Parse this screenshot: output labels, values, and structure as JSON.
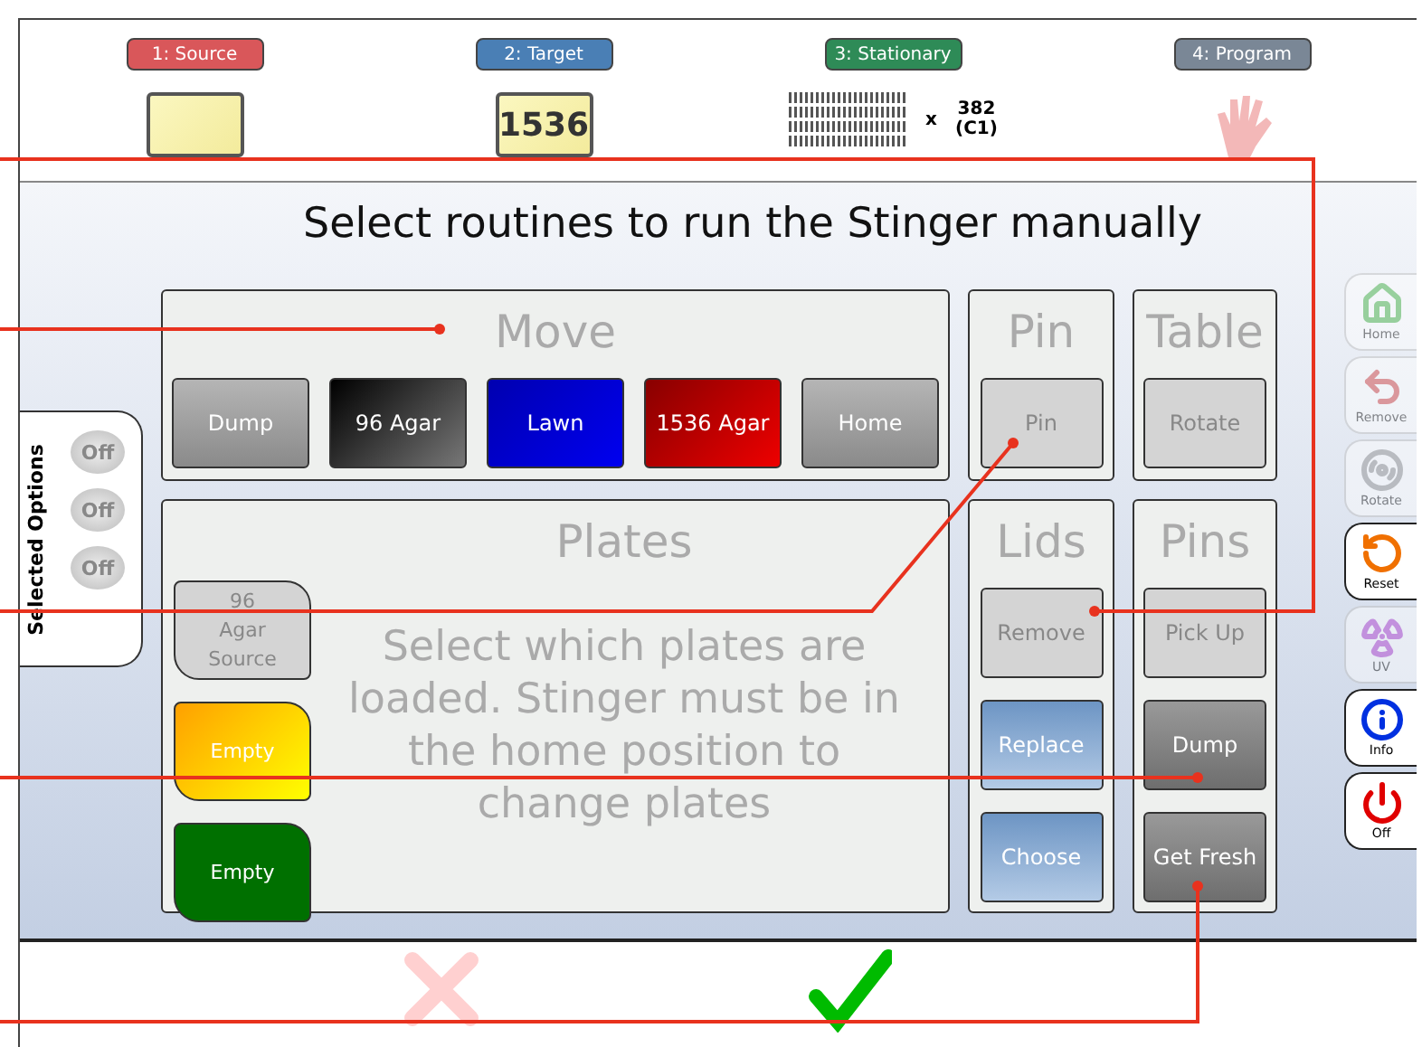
{
  "steps": [
    {
      "kind": "source",
      "label": "1: Source",
      "color": "#d9575a"
    },
    {
      "kind": "target",
      "label": "2: Target",
      "color": "#4a7fb5",
      "plate_text": "1536"
    },
    {
      "kind": "stationary",
      "label": "3: Stationary",
      "color": "#2e8b57",
      "multiplier": "x",
      "count": "382",
      "unit": "(C1)"
    },
    {
      "kind": "program",
      "label": "4: Program",
      "color": "#7a8796"
    }
  ],
  "title": "Select routines to run the Stinger manually",
  "side_tab": {
    "title": "Selected Options",
    "options": [
      {
        "label": "Off"
      },
      {
        "label": "Off"
      },
      {
        "label": "Off"
      }
    ]
  },
  "panels_top": [
    {
      "title": "Move",
      "buttons": [
        {
          "label": "Dump",
          "kind": "grey"
        },
        {
          "label": "96 Agar",
          "kind": "black"
        },
        {
          "label": "Lawn",
          "kind": "blue"
        },
        {
          "label": "1536 Agar",
          "kind": "red"
        },
        {
          "label": "Home",
          "kind": "grey"
        }
      ]
    },
    {
      "title": "Pin",
      "buttons": [
        {
          "label": "Pin",
          "kind": "disabled"
        }
      ]
    },
    {
      "title": "Table",
      "buttons": [
        {
          "label": "Rotate",
          "kind": "disabled"
        }
      ]
    }
  ],
  "plates": {
    "title": "Plates",
    "buttons": [
      {
        "label": "96 Agar Source",
        "kind": "disabled"
      },
      {
        "label": "Empty",
        "kind": "yellow"
      },
      {
        "label": "Empty",
        "kind": "green"
      }
    ],
    "message": "Select which plates are loaded. Stinger must be in the home position to change plates"
  },
  "panels_bottom": [
    {
      "title": "Lids",
      "buttons": [
        {
          "label": "Remove",
          "kind": "disabled"
        },
        {
          "label": "Replace",
          "kind": "steel"
        },
        {
          "label": "Choose",
          "kind": "steel"
        }
      ]
    },
    {
      "title": "Pins",
      "buttons": [
        {
          "label": "Pick Up",
          "kind": "disabled"
        },
        {
          "label": "Dump",
          "kind": "dark"
        },
        {
          "label": "Get Fresh",
          "kind": "dark"
        }
      ]
    }
  ],
  "toolbar": [
    {
      "kind": "home",
      "label": "Home",
      "disabled": true
    },
    {
      "kind": "remove",
      "label": "Remove",
      "disabled": true
    },
    {
      "kind": "rotate",
      "label": "Rotate",
      "disabled": true
    },
    {
      "kind": "reset",
      "label": "Reset",
      "disabled": false
    },
    {
      "kind": "uv",
      "label": "UV",
      "disabled": true
    },
    {
      "kind": "info",
      "label": "Info",
      "disabled": false
    },
    {
      "kind": "off",
      "label": "Off",
      "disabled": false
    }
  ],
  "actions": [
    {
      "kind": "cancel",
      "disabled": true
    },
    {
      "kind": "ok",
      "disabled": false
    }
  ]
}
